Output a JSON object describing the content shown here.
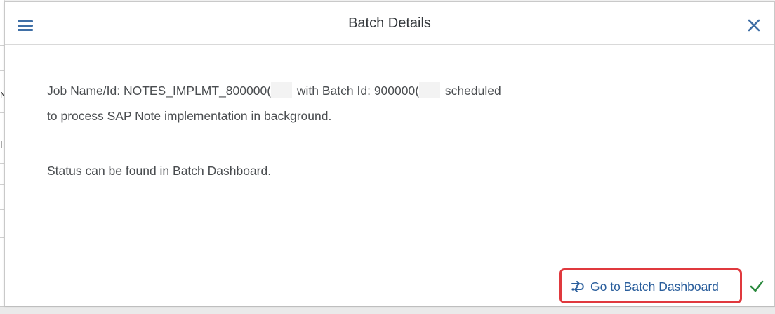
{
  "background": {
    "glyphs": [
      "N",
      "I"
    ]
  },
  "dialog": {
    "title": "Batch Details",
    "body": {
      "line1_prefix": "Job Name/Id: NOTES_IMPLMT_800000(",
      "line1_middle": "with Batch Id: 900000(",
      "line1_suffix": "scheduled",
      "line2": "to process SAP Note implementation in background.",
      "line3": "Status can be found in Batch Dashboard."
    },
    "footer": {
      "dashboard_button_label": "Go to Batch Dashboard"
    }
  },
  "icons": {
    "menu": "hamburger-menu-icon",
    "close": "close-icon",
    "dashboard": "batch-dashboard-icon",
    "confirm": "checkmark-icon"
  },
  "colors": {
    "accent_blue": "#3f6fa6",
    "link_blue": "#2a5e9c",
    "highlight_red": "#e0393e",
    "confirm_green": "#2b8a3e",
    "text_gray": "#4a4d50"
  }
}
